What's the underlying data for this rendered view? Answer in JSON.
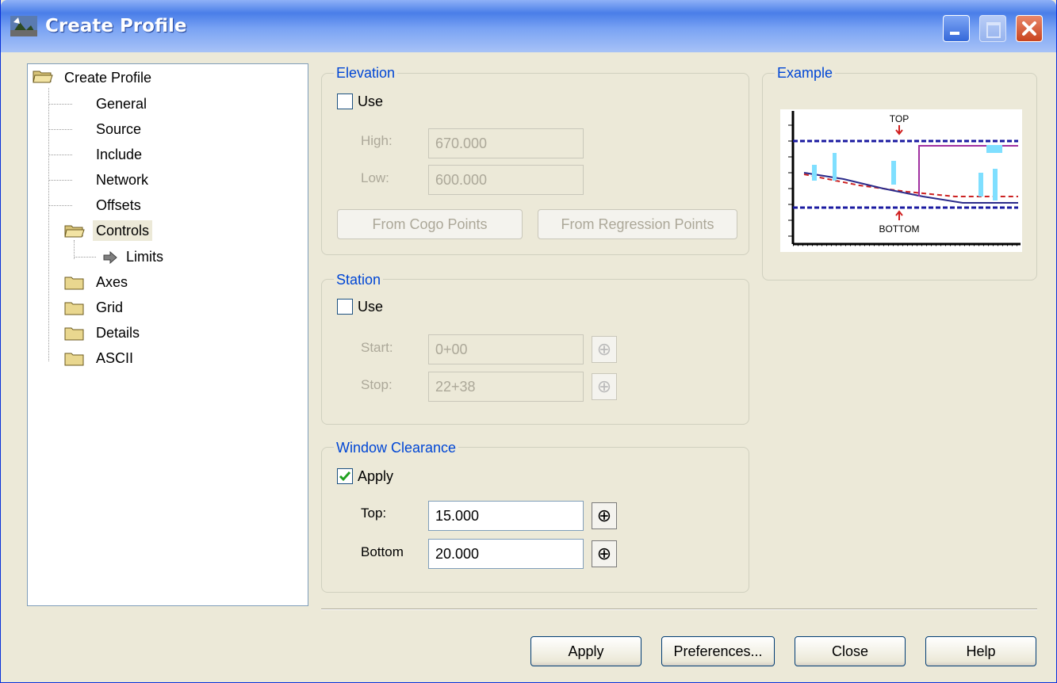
{
  "window": {
    "title": "Create Profile"
  },
  "tree": {
    "root": "Create Profile",
    "items": [
      "General",
      "Source",
      "Include",
      "Network",
      "Offsets"
    ],
    "controls": "Controls",
    "limits": "Limits",
    "folders": [
      "Axes",
      "Grid",
      "Details",
      "ASCII"
    ]
  },
  "elevation": {
    "legend": "Elevation",
    "use_label": "Use",
    "use_checked": false,
    "high_label": "High:",
    "high_value": "670.000",
    "low_label": "Low:",
    "low_value": "600.000",
    "cogo_button": "From Cogo Points",
    "regression_button": "From Regression Points"
  },
  "station": {
    "legend": "Station",
    "use_label": "Use",
    "use_checked": false,
    "start_label": "Start:",
    "start_value": "0+00",
    "stop_label": "Stop:",
    "stop_value": "22+38"
  },
  "clearance": {
    "legend": "Window Clearance",
    "apply_label": "Apply",
    "apply_checked": true,
    "top_label": "Top:",
    "top_value": "15.000",
    "bottom_label": "Bottom",
    "bottom_value": "20.000"
  },
  "example": {
    "legend": "Example",
    "top_text": "TOP",
    "bottom_text": "BOTTOM"
  },
  "buttons": {
    "apply": "Apply",
    "preferences": "Preferences...",
    "close": "Close",
    "help": "Help"
  },
  "colors": {
    "titlebar": "#3468d9",
    "legend": "#0046d5",
    "check": "#21a121"
  }
}
